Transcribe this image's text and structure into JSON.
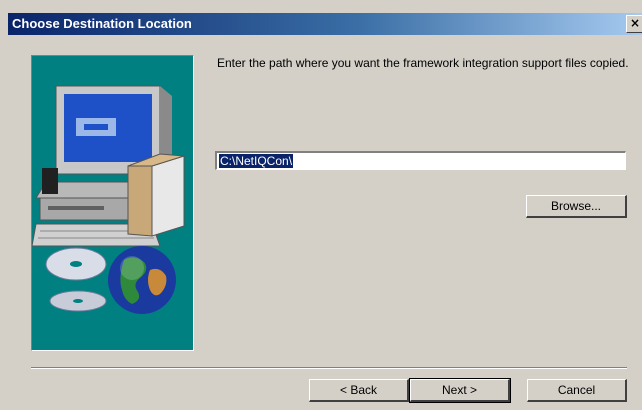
{
  "dialog": {
    "title": "Choose Destination Location",
    "close_glyph": "×",
    "prompt": "Enter the path where you want the framework integration support files copied.",
    "path_value": "C:\\NetIQCon\\",
    "browse_label": "Browse...",
    "back_label": "< Back",
    "next_label": "Next >",
    "cancel_label": "Cancel"
  },
  "colors": {
    "face": "#d4d0c8",
    "title_gradient_start": "#0a246a",
    "side_panel": "#008080",
    "selection": "#0a246a"
  },
  "icons": [
    "close-icon",
    "computer-illustration",
    "cd-illustration",
    "globe-illustration"
  ]
}
